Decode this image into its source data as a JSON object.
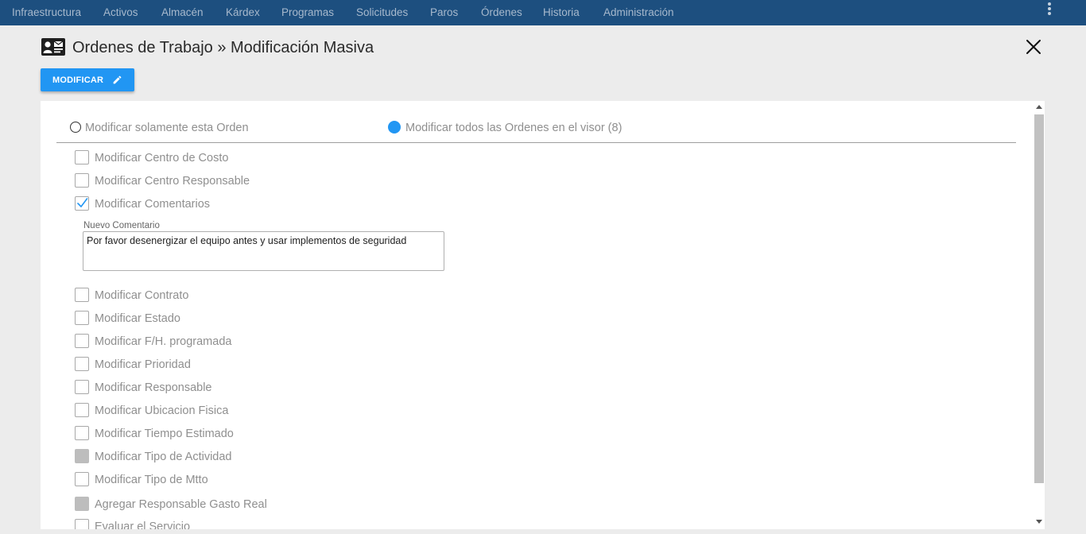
{
  "nav": {
    "items": [
      "Infraestructura",
      "Activos",
      "Almacén",
      "Kárdex",
      "Programas",
      "Solicitudes",
      "Paros",
      "Órdenes",
      "Historia",
      "Administración"
    ]
  },
  "header": {
    "title": "Ordenes de Trabajo » Modificación Masiva"
  },
  "toolbar": {
    "modify_label": "MODIFICAR"
  },
  "scope": {
    "option_single": "Modificar solamente esta Orden",
    "option_all": "Modificar todos las Ordenes en el visor (8)",
    "selected": "all"
  },
  "options": [
    {
      "label": "Modificar Centro de Costo",
      "state": "unchecked"
    },
    {
      "label": "Modificar Centro Responsable",
      "state": "unchecked"
    },
    {
      "label": "Modificar Comentarios",
      "state": "checked"
    },
    {
      "label": "Modificar Contrato",
      "state": "unchecked"
    },
    {
      "label": "Modificar Estado",
      "state": "unchecked"
    },
    {
      "label": "Modificar F/H. programada",
      "state": "unchecked"
    },
    {
      "label": "Modificar Prioridad",
      "state": "unchecked"
    },
    {
      "label": "Modificar Responsable",
      "state": "unchecked"
    },
    {
      "label": "Modificar Ubicacion Fisica",
      "state": "unchecked"
    },
    {
      "label": "Modificar Tiempo Estimado",
      "state": "unchecked"
    },
    {
      "label": "Modificar Tipo de Actividad",
      "state": "disabled"
    },
    {
      "label": "Modificar Tipo de Mtto",
      "state": "unchecked"
    },
    {
      "label": "Agregar Responsable Gasto Real",
      "state": "disabled"
    },
    {
      "label": "Evaluar el Servicio",
      "state": "unchecked"
    }
  ],
  "comment": {
    "label": "Nuevo Comentario",
    "value": "Por favor desenergizar el equipo antes y usar implementos de seguridad"
  },
  "colors": {
    "topbar": "#1d4f7f",
    "accent": "#2196f3",
    "background": "#ececec"
  },
  "icons": {
    "header": "contact-card-icon",
    "close": "close-icon",
    "button": "pencil-icon",
    "menu": "more-vert-icon"
  }
}
